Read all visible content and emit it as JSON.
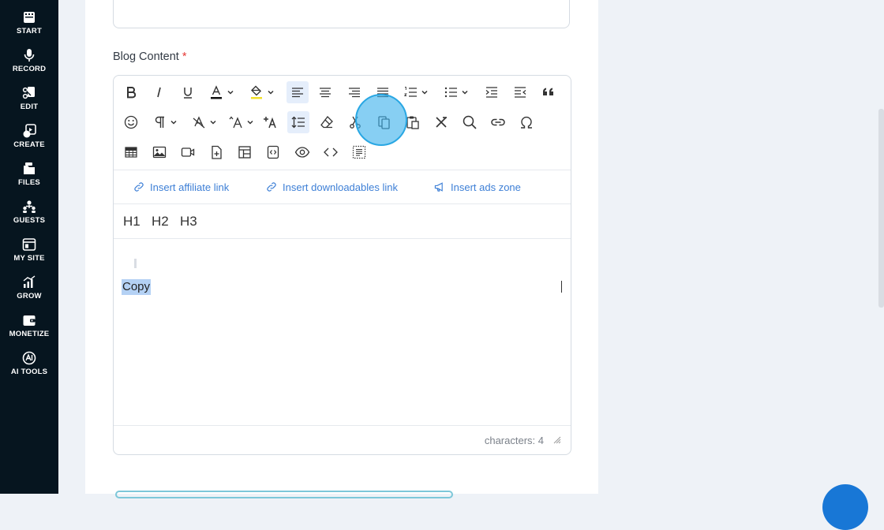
{
  "sidebar": {
    "items": [
      {
        "label": "START",
        "icon": "film-icon"
      },
      {
        "label": "RECORD",
        "icon": "microphone-icon"
      },
      {
        "label": "EDIT",
        "icon": "scissors-icon"
      },
      {
        "label": "CREATE",
        "icon": "create-icon"
      },
      {
        "label": "FILES",
        "icon": "files-icon"
      },
      {
        "label": "GUESTS",
        "icon": "guests-icon"
      },
      {
        "label": "MY SITE",
        "icon": "site-icon"
      },
      {
        "label": "GROW",
        "icon": "chart-icon"
      },
      {
        "label": "MONETIZE",
        "icon": "wallet-icon"
      },
      {
        "label": "AI TOOLS",
        "icon": "ai-icon"
      }
    ]
  },
  "form": {
    "blog_content_label": "Blog Content",
    "required_marker": "*"
  },
  "editor": {
    "toolbar_font_letter": "A",
    "toolbar_small_a": "A",
    "heading_buttons": [
      "H1",
      "H2",
      "H3"
    ],
    "quick_links": {
      "affiliate": "Insert affiliate link",
      "downloadables": "Insert downloadables link",
      "ads": "Insert ads zone"
    },
    "content_text": "Copy",
    "status": "characters: 4"
  },
  "colors": {
    "sidebar_bg": "#06151f",
    "accent_link": "#3d7fd6",
    "selection": "#b4d1f4",
    "click_highlight": "#3eb2ec",
    "required": "#e53935"
  }
}
